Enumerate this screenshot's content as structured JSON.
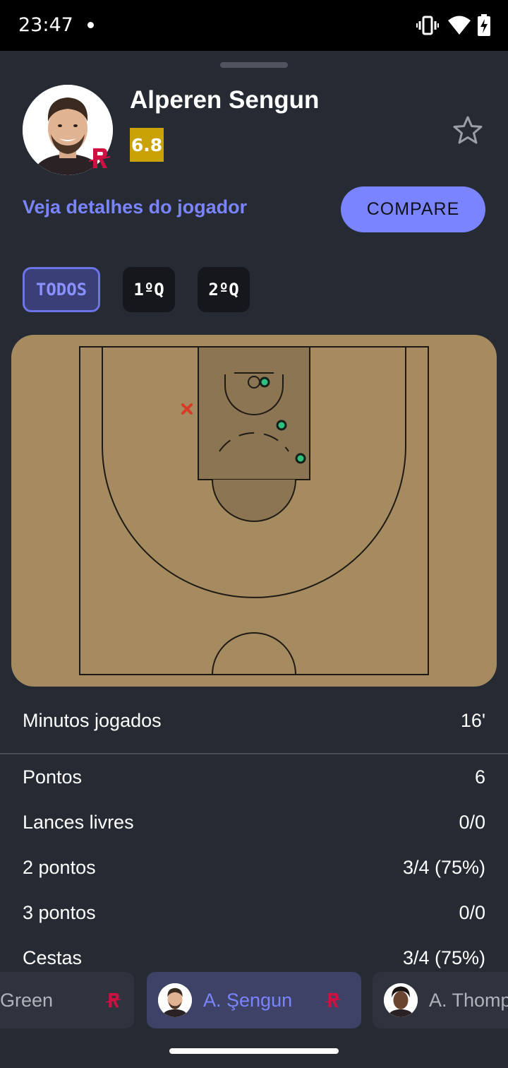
{
  "status_bar": {
    "time": "23:47",
    "icons": [
      "vibrate-icon",
      "wifi-icon",
      "battery-charging-icon"
    ]
  },
  "player": {
    "first_name": "Alperen",
    "last_name": "Sengun",
    "rating": "6.8",
    "details_link": "Veja detalhes do jogador",
    "compare_label": "COMPARE",
    "favorite_icon": "star-outline-icon"
  },
  "filters": {
    "items": [
      "TODOS",
      "1ºQ",
      "2ºQ"
    ],
    "selected": "TODOS"
  },
  "shot_map": {
    "made_shots": 3,
    "missed_shots": 1,
    "colors": {
      "court": "#a58b5f",
      "paint": "#8b7553",
      "made": "#2fbf7f",
      "missed": "#d93a25"
    }
  },
  "stats": {
    "minutes_label": "Minutos jogados",
    "minutes_value": "16'",
    "rows": [
      {
        "label": "Pontos",
        "value": "6"
      },
      {
        "label": "Lances livres",
        "value": "0/0"
      },
      {
        "label": "2 pontos",
        "value": "3/4 (75%)"
      },
      {
        "label": "3 pontos",
        "value": "0/0"
      },
      {
        "label": "Cestas",
        "value": "3/4 (75%)"
      }
    ]
  },
  "player_strip": {
    "players": [
      {
        "name": "Green",
        "selected": false
      },
      {
        "name": "A. Şengun",
        "selected": true
      },
      {
        "name": "A. Thomp",
        "selected": false
      }
    ]
  },
  "colors": {
    "accent": "#7b84ff",
    "background": "#262a33",
    "rating": "#c9a306"
  }
}
